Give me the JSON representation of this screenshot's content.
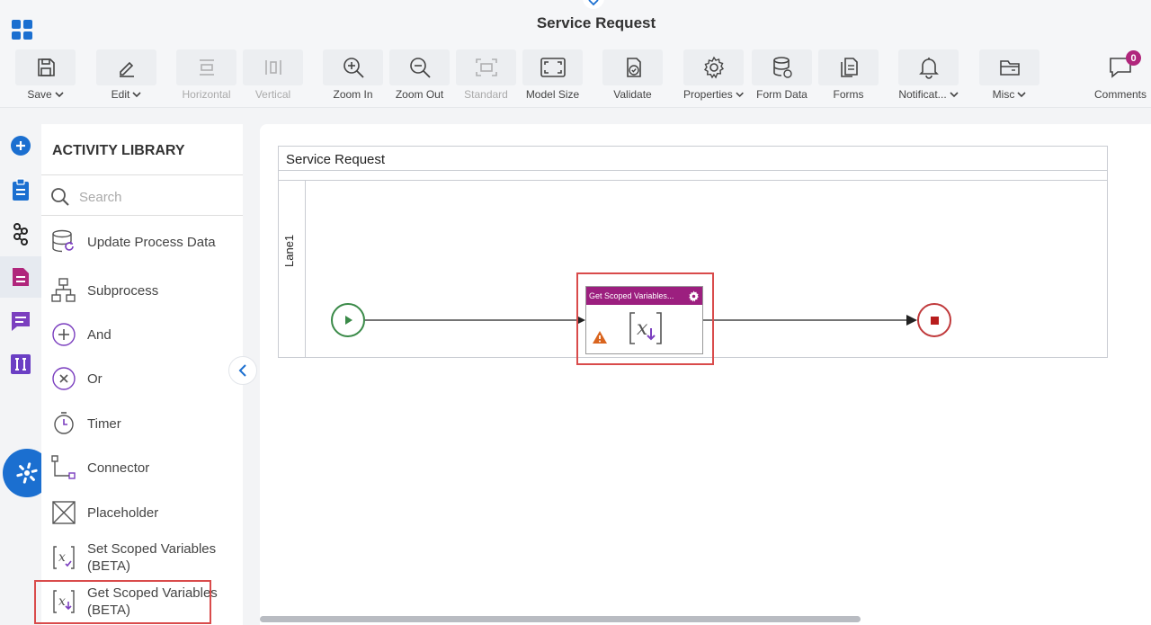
{
  "header": {
    "title": "Service Request"
  },
  "toolbar": [
    {
      "id": "save",
      "label": "Save",
      "icon": "save-icon",
      "dropdown": true,
      "disabled": false
    },
    {
      "id": "edit",
      "label": "Edit",
      "icon": "pencil-icon",
      "dropdown": true,
      "disabled": false
    },
    {
      "id": "horizontal",
      "label": "Horizontal",
      "icon": "align-horizontal-icon",
      "dropdown": false,
      "disabled": true
    },
    {
      "id": "vertical",
      "label": "Vertical",
      "icon": "align-vertical-icon",
      "dropdown": false,
      "disabled": true
    },
    {
      "id": "zoom-in",
      "label": "Zoom In",
      "icon": "zoom-in-icon",
      "dropdown": false,
      "disabled": false
    },
    {
      "id": "zoom-out",
      "label": "Zoom Out",
      "icon": "zoom-out-icon",
      "dropdown": false,
      "disabled": false
    },
    {
      "id": "standard",
      "label": "Standard",
      "icon": "standard-size-icon",
      "dropdown": false,
      "disabled": true
    },
    {
      "id": "model-size",
      "label": "Model Size",
      "icon": "fit-screen-icon",
      "dropdown": false,
      "disabled": false
    },
    {
      "id": "validate",
      "label": "Validate",
      "icon": "validate-icon",
      "dropdown": false,
      "disabled": false
    },
    {
      "id": "properties",
      "label": "Properties",
      "icon": "gear-icon",
      "dropdown": true,
      "disabled": false
    },
    {
      "id": "form-data",
      "label": "Form Data",
      "icon": "database-icon",
      "dropdown": false,
      "disabled": false
    },
    {
      "id": "forms",
      "label": "Forms",
      "icon": "forms-icon",
      "dropdown": false,
      "disabled": false
    },
    {
      "id": "notifications",
      "label": "Notificat...",
      "icon": "bell-icon",
      "dropdown": true,
      "disabled": false
    },
    {
      "id": "misc",
      "label": "Misc",
      "icon": "folder-icon",
      "dropdown": true,
      "disabled": false
    }
  ],
  "comments": {
    "label": "Comments",
    "count": "0"
  },
  "library": {
    "title": "ACTIVITY LIBRARY",
    "search_placeholder": "Search",
    "items": [
      {
        "label": "Update Process Data",
        "icon": "update-process-data-icon"
      },
      {
        "label": "Subprocess",
        "icon": "subprocess-icon"
      },
      {
        "label": "And",
        "icon": "and-gateway-icon"
      },
      {
        "label": "Or",
        "icon": "or-gateway-icon"
      },
      {
        "label": "Timer",
        "icon": "timer-icon"
      },
      {
        "label": "Connector",
        "icon": "connector-icon"
      },
      {
        "label": "Placeholder",
        "icon": "placeholder-icon"
      },
      {
        "label": "Set Scoped Variables (BETA)",
        "icon": "set-scoped-variables-icon"
      },
      {
        "label": "Get Scoped Variables (BETA)",
        "icon": "get-scoped-variables-icon"
      }
    ]
  },
  "rail": [
    "add-icon",
    "clipboard-icon",
    "process-icon",
    "form-icon",
    "chat-icon",
    "tools-icon"
  ],
  "canvas": {
    "pool_title": "Service Request",
    "lane_label": "Lane1",
    "task_title": "Get Scoped Variables...",
    "task_icon": "get-scoped-variables-icon",
    "task_warning": "warning-icon"
  },
  "colors": {
    "accent": "#1b6fd0",
    "task_header": "#9c1f7f",
    "highlight": "#d94b4b",
    "start": "#3a8a48",
    "end": "#c0393b",
    "badge": "#b0267c"
  }
}
